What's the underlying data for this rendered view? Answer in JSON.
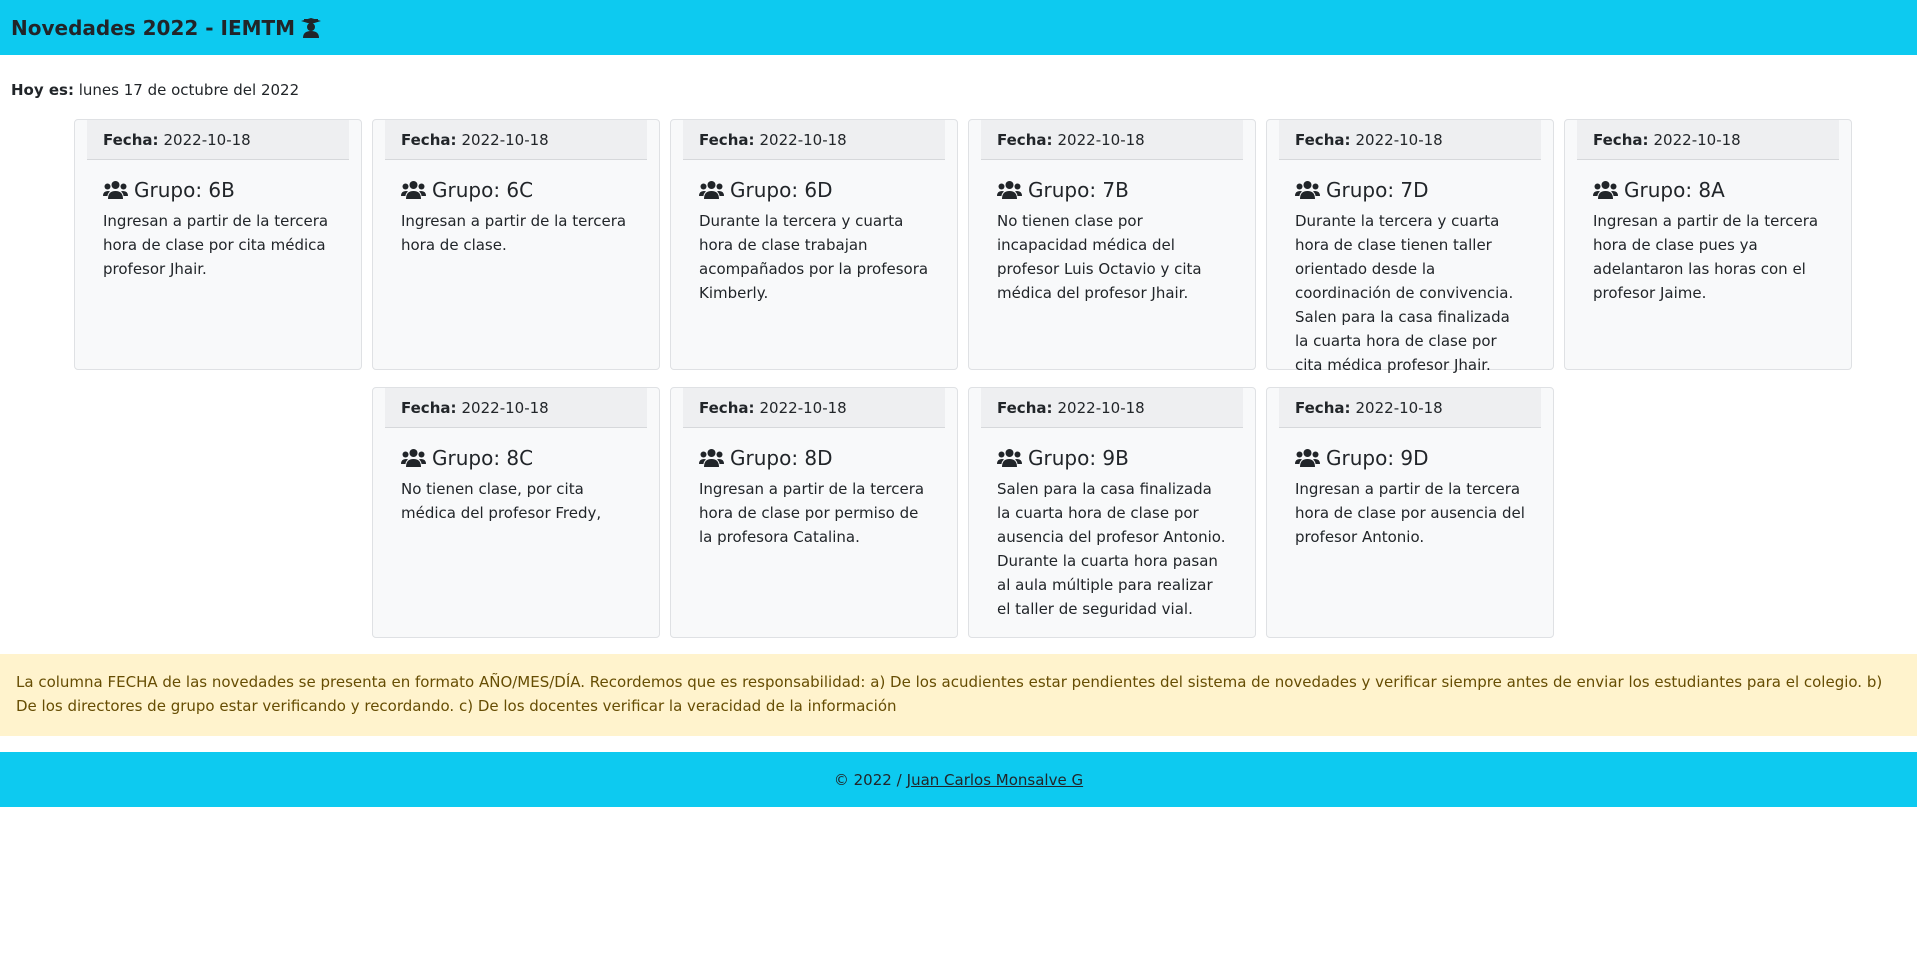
{
  "navbar": {
    "title": "Novedades 2022 - IEMTM",
    "icon": "graduate-icon"
  },
  "today": {
    "label": "Hoy es:",
    "value": "lunes 17 de octubre del 2022"
  },
  "fecha_label": "Fecha:",
  "cards": [
    {
      "date": "2022-10-18",
      "group": "Grupo: 6B",
      "text": "Ingresan a partir de la tercera hora de clase por cita médica profesor Jhair."
    },
    {
      "date": "2022-10-18",
      "group": "Grupo: 6C",
      "text": "Ingresan a partir de la tercera hora de clase."
    },
    {
      "date": "2022-10-18",
      "group": "Grupo: 6D",
      "text": "Durante la tercera y cuarta hora de clase trabajan acompañados por la profesora Kimberly."
    },
    {
      "date": "2022-10-18",
      "group": "Grupo: 7B",
      "text": "No tienen clase por incapacidad médica del profesor Luis Octavio y cita médica del profesor Jhair."
    },
    {
      "date": "2022-10-18",
      "group": "Grupo: 7D",
      "text": "Durante la tercera y cuarta hora de clase tienen taller orientado desde la coordinación de convivencia. Salen para la casa finalizada la cuarta hora de clase por cita médica profesor Jhair."
    },
    {
      "date": "2022-10-18",
      "group": "Grupo: 8A",
      "text": "Ingresan a partir de la tercera hora de clase pues ya adelantaron las horas con el profesor Jaime."
    },
    {
      "date": "2022-10-18",
      "group": "Grupo: 8C",
      "text": "No tienen clase, por cita médica del profesor Fredy,"
    },
    {
      "date": "2022-10-18",
      "group": "Grupo: 8D",
      "text": "Ingresan a partir de la tercera hora de clase por permiso de la profesora Catalina."
    },
    {
      "date": "2022-10-18",
      "group": "Grupo: 9B",
      "text": "Salen para la casa finalizada la cuarta hora de clase por ausencia del profesor Antonio. Durante la cuarta hora pasan al aula múltiple para realizar el taller de seguridad vial."
    },
    {
      "date": "2022-10-18",
      "group": "Grupo: 9D",
      "text": "Ingresan a partir de la tercera hora de clase por ausencia del profesor Antonio."
    }
  ],
  "notice": "La columna FECHA de las novedades se presenta en formato AÑO/MES/DÍA. Recordemos que es responsabilidad: a) De los acudientes estar pendientes del sistema de novedades y verificar siempre antes de enviar los estudiantes para el colegio. b) De los directores de grupo estar verificando y recordando. c) De los docentes verificar la veracidad de la información",
  "footer": {
    "copyright": "© 2022 /",
    "author": "Juan Carlos Monsalve G"
  },
  "colors": {
    "navbar": "#0dcaf0",
    "notice_bg": "#fff3cd",
    "notice_text": "#664d03"
  }
}
